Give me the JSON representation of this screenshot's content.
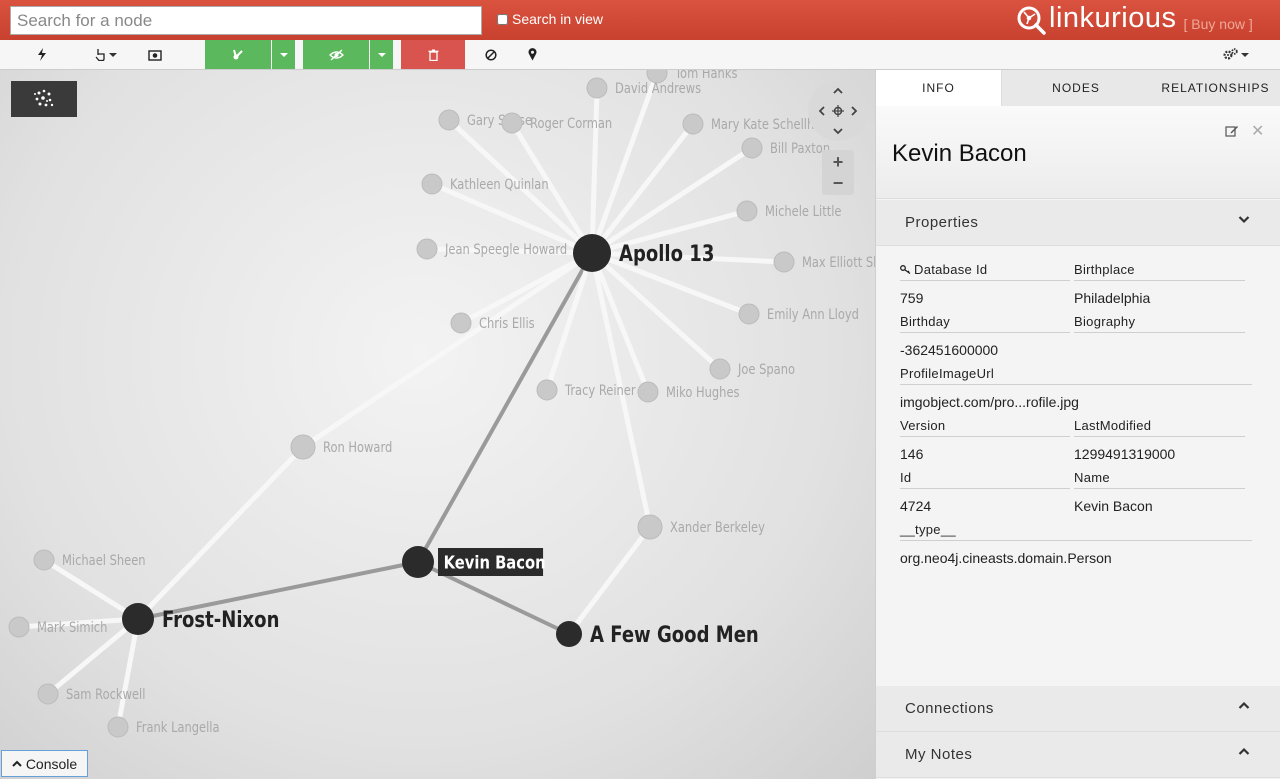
{
  "header": {
    "search_placeholder": "Search for a node",
    "search_in_view_label": "Search in view",
    "logo_text": "linkurious",
    "buy_now": "[ Buy now ]"
  },
  "toolbar": {
    "icons": [
      "lightning-icon",
      "hand-pointer-icon",
      "camera-icon",
      "layout-icon",
      "eye-slash-icon",
      "trash-icon",
      "ban-icon",
      "map-marker-icon",
      "gears-icon"
    ]
  },
  "graph": {
    "nodes": [
      {
        "label": "Apollo 13",
        "kind": "focus"
      },
      {
        "label": "Kevin Bacon",
        "kind": "selected"
      },
      {
        "label": "Frost-Nixon",
        "kind": "focus"
      },
      {
        "label": "A Few Good Men",
        "kind": "focus"
      },
      {
        "label": "Ron Howard",
        "kind": "faded"
      },
      {
        "label": "Xander Berkeley",
        "kind": "faded"
      },
      {
        "label": "Tom Hanks",
        "kind": "faded"
      },
      {
        "label": "David Andrews",
        "kind": "faded"
      },
      {
        "label": "Gary Sinise",
        "kind": "faded"
      },
      {
        "label": "Roger Corman",
        "kind": "faded"
      },
      {
        "label": "Mary Kate Schellhardt",
        "kind": "faded"
      },
      {
        "label": "Bill Paxton",
        "kind": "faded"
      },
      {
        "label": "Kathleen Quinlan",
        "kind": "faded"
      },
      {
        "label": "Michele Little",
        "kind": "faded"
      },
      {
        "label": "Jean Speegle Howard",
        "kind": "faded"
      },
      {
        "label": "Max Elliott Slade",
        "kind": "faded"
      },
      {
        "label": "Chris Ellis",
        "kind": "faded"
      },
      {
        "label": "Emily Ann Lloyd",
        "kind": "faded"
      },
      {
        "label": "Joe Spano",
        "kind": "faded"
      },
      {
        "label": "Tracy Reiner",
        "kind": "faded"
      },
      {
        "label": "Miko Hughes",
        "kind": "faded"
      },
      {
        "label": "Michael Sheen",
        "kind": "faded"
      },
      {
        "label": "Mark Simich",
        "kind": "faded"
      },
      {
        "label": "Sam Rockwell",
        "kind": "faded"
      },
      {
        "label": "Frank Langella",
        "kind": "faded"
      }
    ],
    "edges": [
      [
        "Kevin Bacon",
        "Apollo 13"
      ],
      [
        "Kevin Bacon",
        "Frost-Nixon"
      ],
      [
        "Kevin Bacon",
        "A Few Good Men"
      ],
      [
        "Apollo 13",
        "Tom Hanks"
      ],
      [
        "Apollo 13",
        "David Andrews"
      ],
      [
        "Apollo 13",
        "Gary Sinise"
      ],
      [
        "Apollo 13",
        "Roger Corman"
      ],
      [
        "Apollo 13",
        "Mary Kate Schellhardt"
      ],
      [
        "Apollo 13",
        "Bill Paxton"
      ],
      [
        "Apollo 13",
        "Kathleen Quinlan"
      ],
      [
        "Apollo 13",
        "Michele Little"
      ],
      [
        "Apollo 13",
        "Jean Speegle Howard"
      ],
      [
        "Apollo 13",
        "Max Elliott Slade"
      ],
      [
        "Apollo 13",
        "Chris Ellis"
      ],
      [
        "Apollo 13",
        "Emily Ann Lloyd"
      ],
      [
        "Apollo 13",
        "Joe Spano"
      ],
      [
        "Apollo 13",
        "Tracy Reiner"
      ],
      [
        "Apollo 13",
        "Miko Hughes"
      ],
      [
        "Apollo 13",
        "Ron Howard"
      ],
      [
        "Apollo 13",
        "Xander Berkeley"
      ],
      [
        "Frost-Nixon",
        "Ron Howard"
      ],
      [
        "Frost-Nixon",
        "Michael Sheen"
      ],
      [
        "Frost-Nixon",
        "Mark Simich"
      ],
      [
        "Frost-Nixon",
        "Sam Rockwell"
      ],
      [
        "Frost-Nixon",
        "Frank Langella"
      ],
      [
        "A Few Good Men",
        "Xander Berkeley"
      ]
    ],
    "console_label": "Console"
  },
  "panel": {
    "tabs": [
      {
        "label": "INFO",
        "active": true
      },
      {
        "label": "NODES",
        "active": false
      },
      {
        "label": "RELATIONSHIPS",
        "active": false
      }
    ],
    "node_title": "Kevin Bacon",
    "properties_label": "Properties",
    "properties": [
      {
        "key": "Database Id",
        "value": "759"
      },
      {
        "key": "Birthplace",
        "value": "Philadelphia"
      },
      {
        "key": "Birthday",
        "value": "-362451600000"
      },
      {
        "key": "Biography",
        "value": ""
      },
      {
        "key": "ProfileImageUrl",
        "value": "imgobject.com/pro...rofile.jpg"
      },
      {
        "key": "Version",
        "value": "146"
      },
      {
        "key": "LastModified",
        "value": "1299491319000"
      },
      {
        "key": "Id",
        "value": "4724"
      },
      {
        "key": "Name",
        "value": "Kevin Bacon"
      },
      {
        "key": "__type__",
        "value": "org.neo4j.cineasts.domain.Person"
      }
    ],
    "connections_label": "Connections",
    "notes_label": "My Notes"
  },
  "colors": {
    "header_red": "#d04a37",
    "green_button": "#5cb85c",
    "red_button": "#d9534f",
    "node_dark": "#2b2b2b"
  }
}
